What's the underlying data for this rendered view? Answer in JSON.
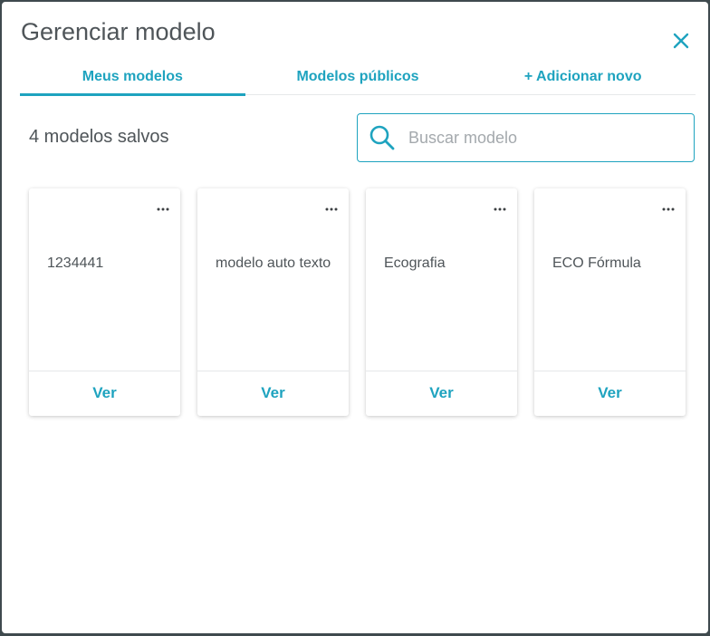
{
  "modal": {
    "title": "Gerenciar modelo",
    "close_icon": "close-icon"
  },
  "tabs": [
    {
      "label": "Meus modelos",
      "active": true
    },
    {
      "label": "Modelos públicos",
      "active": false
    },
    {
      "label": "+ Adicionar novo",
      "active": false
    }
  ],
  "saved_count": "4 modelos salvos",
  "search": {
    "placeholder": "Buscar modelo",
    "value": "",
    "icon": "search-icon"
  },
  "cards": [
    {
      "name": "1234441",
      "menu_label": "...",
      "action": "Ver"
    },
    {
      "name": "modelo auto texto",
      "menu_label": "...",
      "action": "Ver"
    },
    {
      "name": "Ecografia",
      "menu_label": "...",
      "action": "Ver"
    },
    {
      "name": "ECO Fórmula",
      "menu_label": "...",
      "action": "Ver"
    }
  ],
  "colors": {
    "accent": "#1ea3bf",
    "text": "#4f5559",
    "placeholder": "#a4a9ad",
    "divider": "#e6e8ea"
  }
}
